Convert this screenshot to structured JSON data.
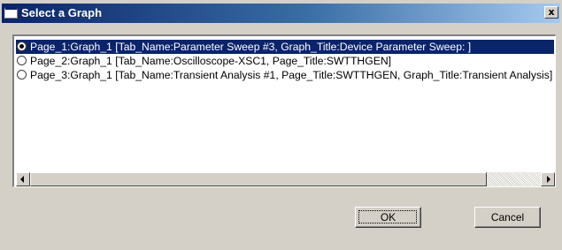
{
  "window": {
    "title": "Select a Graph",
    "close_label": "x"
  },
  "list": {
    "items": [
      {
        "label": "Page_1:Graph_1 [Tab_Name:Parameter Sweep #3, Graph_Title:Device Parameter Sweep: ]",
        "selected": true
      },
      {
        "label": "Page_2:Graph_1 [Tab_Name:Oscilloscope-XSC1, Page_Title:SWTTHGEN]",
        "selected": false
      },
      {
        "label": "Page_3:Graph_1 [Tab_Name:Transient Analysis #1, Page_Title:SWTTHGEN, Graph_Title:Transient Analysis]",
        "selected": false
      }
    ]
  },
  "buttons": {
    "ok_label": "OK",
    "cancel_label": "Cancel"
  },
  "colors": {
    "selection": "#0a246a",
    "titlebar_start": "#0a246a",
    "titlebar_end": "#a6caf0",
    "face": "#d4d0c8"
  },
  "icons": {
    "title": "window-icon",
    "close": "close-icon",
    "scroll_left": "arrow-left-icon",
    "scroll_right": "arrow-right-icon"
  }
}
